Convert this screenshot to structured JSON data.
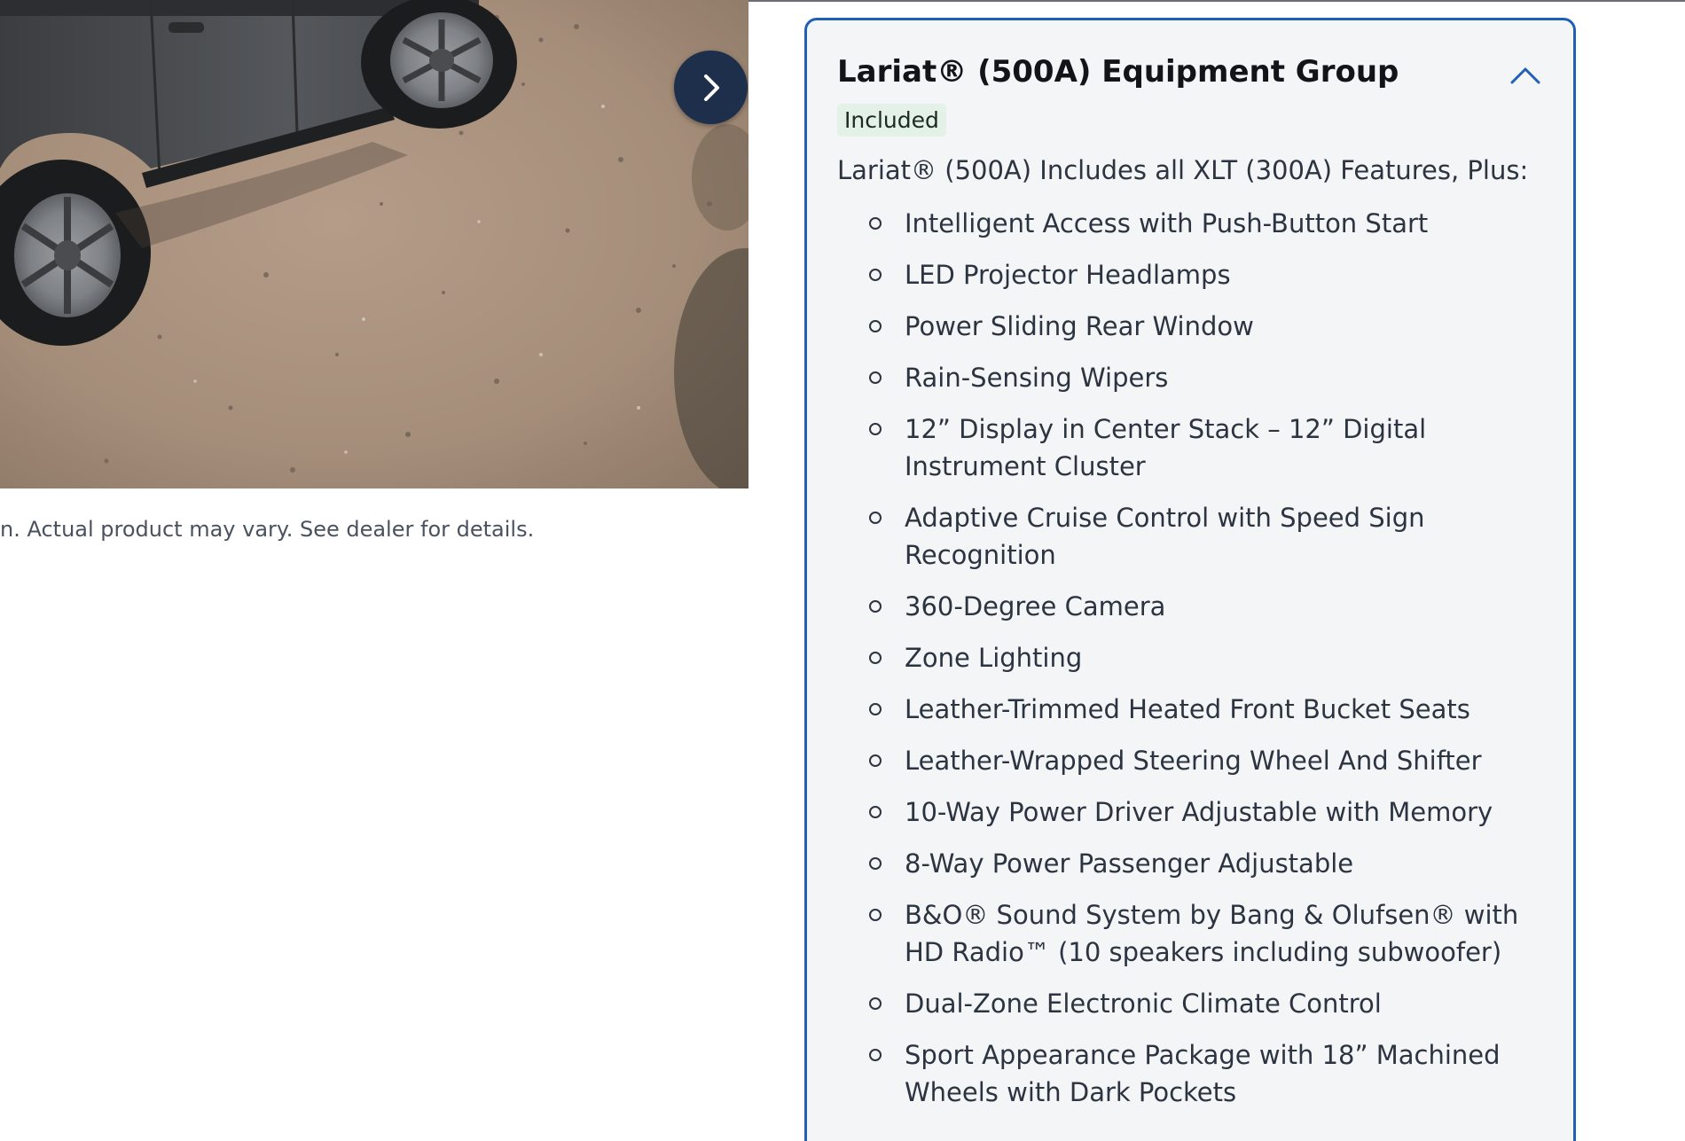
{
  "gallery": {
    "image_alt": "Dark gray pickup truck parked on a dirt and gravel surface",
    "next_icon": "chevron-right-icon",
    "disclaimer": "n. Actual product may vary. See dealer for details."
  },
  "package": {
    "title": "Lariat® (500A) Equipment Group",
    "badge": "Included",
    "collapse_icon": "chevron-up-icon",
    "intro": "Lariat® (500A) Includes all XLT (300A) Features, Plus:",
    "features": [
      "Intelligent Access with Push-Button Start",
      "LED Projector Headlamps",
      "Power Sliding Rear Window",
      "Rain-Sensing Wipers",
      "12” Display in Center Stack – 12” Digital Instrument Cluster",
      "Adaptive Cruise Control with Speed Sign Recognition",
      "360-Degree Camera",
      "Zone Lighting",
      "Leather-Trimmed Heated Front Bucket Seats",
      "Leather-Wrapped Steering Wheel And Shifter",
      "10-Way Power Driver Adjustable with Memory",
      "8-Way Power Passenger Adjustable",
      "B&O® Sound System by Bang & Olufsen® with HD Radio™ (10 speakers including subwoofer)",
      "Dual-Zone Electronic Climate Control",
      "Sport Appearance Package with 18” Machined Wheels with Dark Pockets"
    ]
  },
  "colors": {
    "panel_border": "#1f5fb4",
    "panel_background": "#f4f5f7",
    "badge_background": "#e3f1e6",
    "nav_button": "#1d2f4a"
  }
}
